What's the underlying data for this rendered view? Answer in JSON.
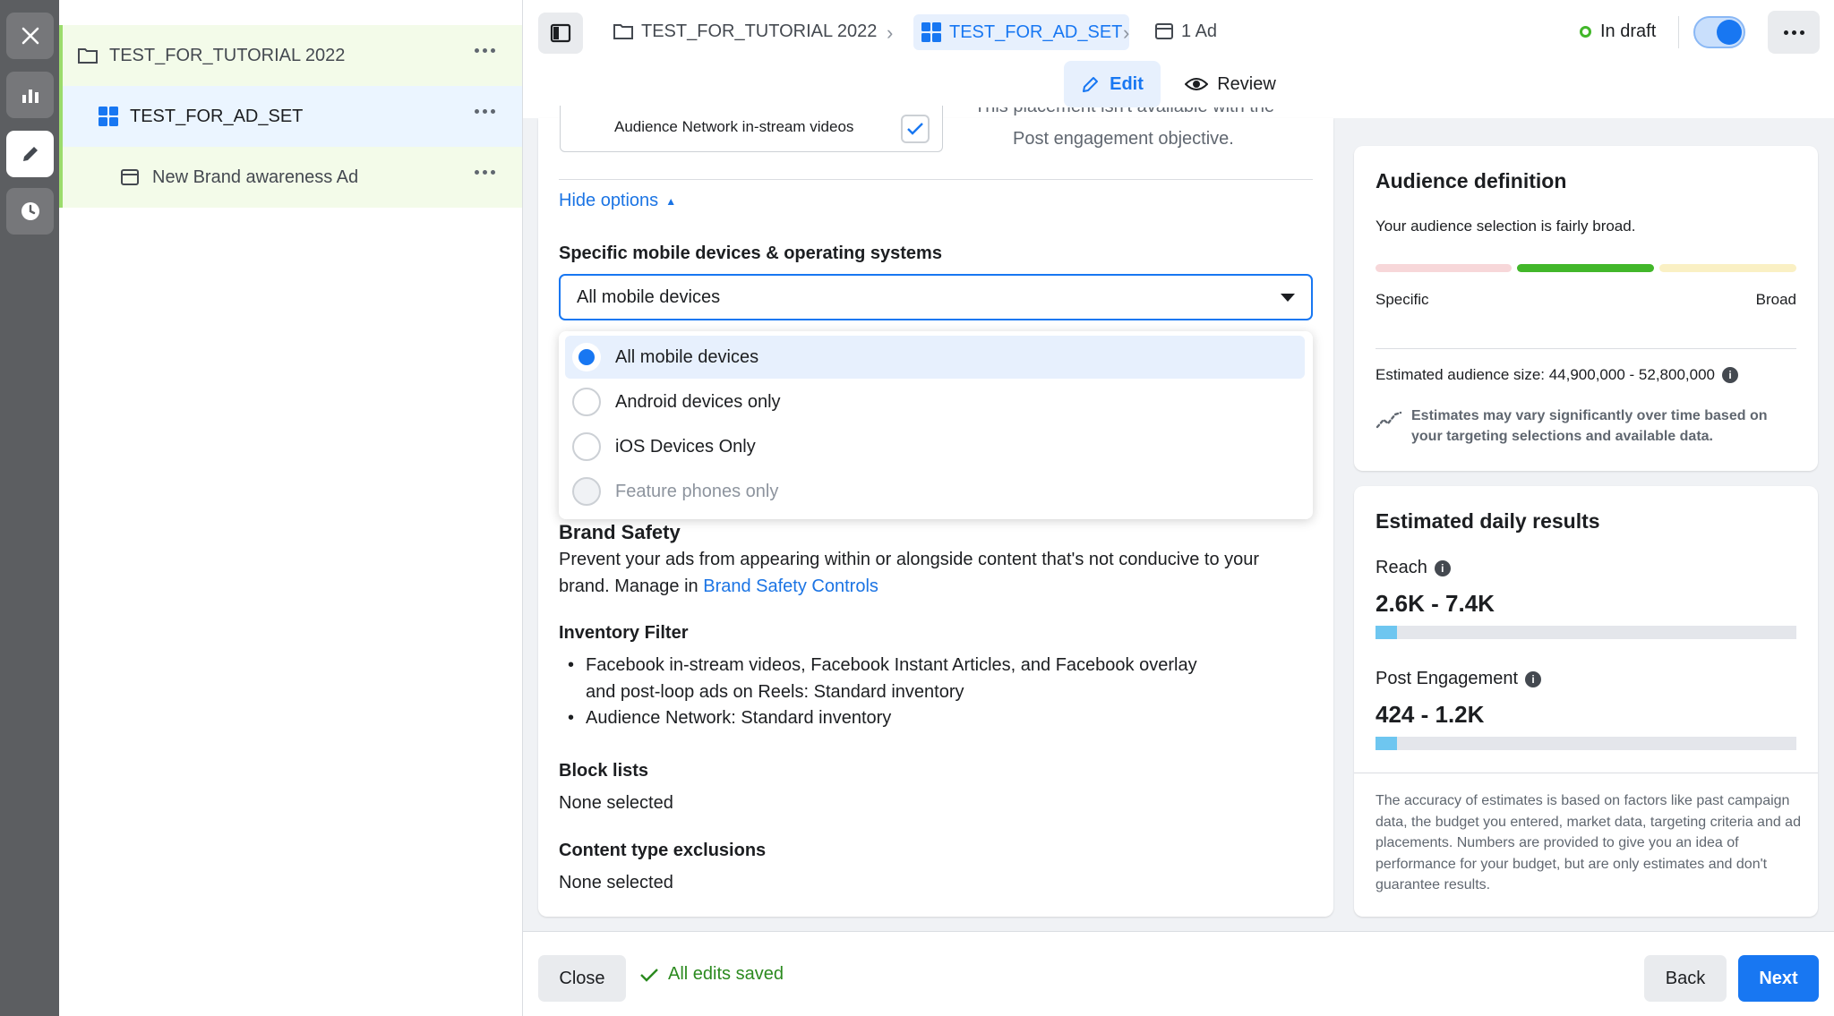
{
  "rail": {
    "icons": [
      "close-icon",
      "chart-icon",
      "pencil-icon",
      "clock-icon"
    ]
  },
  "tree": {
    "campaign": "TEST_FOR_TUTORIAL 2022",
    "ad_set": "TEST_FOR_AD_SET",
    "ad": "New Brand awareness Ad"
  },
  "header": {
    "crumb_campaign": "TEST_FOR_TUTORIAL 2022",
    "crumb_ad_set": "TEST_FOR_AD_SET",
    "crumb_ad": "1 Ad",
    "status": "In draft",
    "toggle_on": true,
    "edit_label": "Edit",
    "review_label": "Review"
  },
  "placements": {
    "checkbox_label": "Audience Network in-stream videos",
    "partial_note": "This placement isn't available with the",
    "note": "Post engagement objective.",
    "hide_options": "Hide options"
  },
  "devices": {
    "heading": "Specific mobile devices & operating systems",
    "selected": "All mobile devices",
    "options": [
      {
        "label": "All mobile devices",
        "selected": true,
        "disabled": false
      },
      {
        "label": "Android devices only",
        "selected": false,
        "disabled": false
      },
      {
        "label": "iOS Devices Only",
        "selected": false,
        "disabled": false
      },
      {
        "label": "Feature phones only",
        "selected": false,
        "disabled": true
      }
    ]
  },
  "brand_safety": {
    "heading": "Brand Safety",
    "desc": "Prevent your ads from appearing within or alongside content that's not conducive to your",
    "desc2": "brand. Manage in",
    "link": "Brand Safety Controls"
  },
  "inventory": {
    "heading": "Inventory Filter",
    "bullet1a": "Facebook in-stream videos, Facebook Instant Articles, and Facebook overlay",
    "bullet1b": "and post-loop ads on Reels: Standard inventory",
    "bullet2": "Audience Network: Standard inventory"
  },
  "block_lists": {
    "heading": "Block lists",
    "value": "None selected"
  },
  "content_exclusions": {
    "heading": "Content type exclusions",
    "value": "None selected"
  },
  "audience": {
    "title": "Audience definition",
    "subtitle": "Your audience selection is fairly broad.",
    "specific": "Specific",
    "broad": "Broad",
    "size_label": "Estimated audience size: 44,900,000 - 52,800,000",
    "note": "Estimates may vary significantly over time based on your targeting selections and available data.",
    "colors": {
      "specific": "#f7d7d9",
      "fairly_broad": "#42b72a",
      "broad": "#faf0c4"
    }
  },
  "daily": {
    "title": "Estimated daily results",
    "reach_label": "Reach",
    "reach_value": "2.6K - 7.4K",
    "reach_fill": 0.05,
    "engagement_label": "Post Engagement",
    "engagement_value": "424 - 1.2K",
    "engagement_fill": 0.05,
    "disclaimer": "The accuracy of estimates is based on factors like past campaign data, the budget you entered, market data, targeting criteria and ad placements. Numbers are provided to give you an idea of performance for your budget, but are only estimates and don't guarantee results."
  },
  "footer": {
    "close": "Close",
    "saved": "All edits saved",
    "back": "Back",
    "next": "Next"
  }
}
